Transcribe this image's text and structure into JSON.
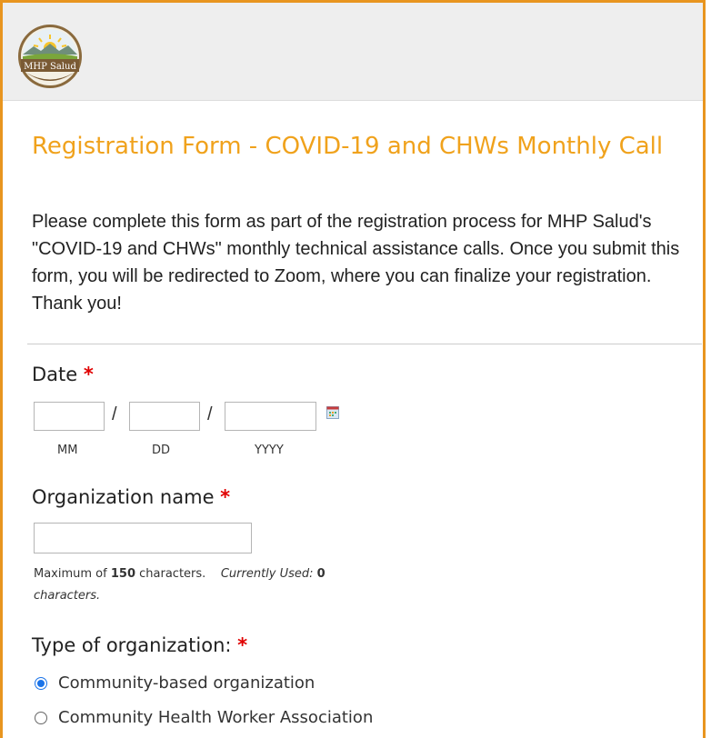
{
  "logo": {
    "text": "MHP Salud"
  },
  "form": {
    "title": "Registration Form - COVID-19 and CHWs Monthly Call",
    "intro": "Please complete this form as part of the registration process for MHP Salud's \"COVID-19 and CHWs\" monthly technical assistance calls. Once you submit this form, you will be redirected to Zoom, where you can finalize your registration. Thank you!"
  },
  "date": {
    "label": "Date",
    "required": "*",
    "separator": "/",
    "mm_label": "MM",
    "dd_label": "DD",
    "yyyy_label": "YYYY",
    "mm_value": "",
    "dd_value": "",
    "yyyy_value": ""
  },
  "org_name": {
    "label": "Organization name",
    "required": "*",
    "value": "",
    "help_prefix": "Maximum of ",
    "help_max": "150",
    "help_mid": " characters.",
    "help_used_label": "Currently Used:",
    "help_used_value": "0",
    "help_suffix": "characters."
  },
  "org_type": {
    "label": "Type of organization:",
    "required": "*",
    "options": [
      {
        "label": "Community-based organization",
        "selected": true
      },
      {
        "label": "Community Health Worker Association",
        "selected": false
      }
    ]
  },
  "colors": {
    "accent": "#f0a21c",
    "frame": "#e8951f",
    "required": "#e00000",
    "radio": "#1a73e8"
  }
}
